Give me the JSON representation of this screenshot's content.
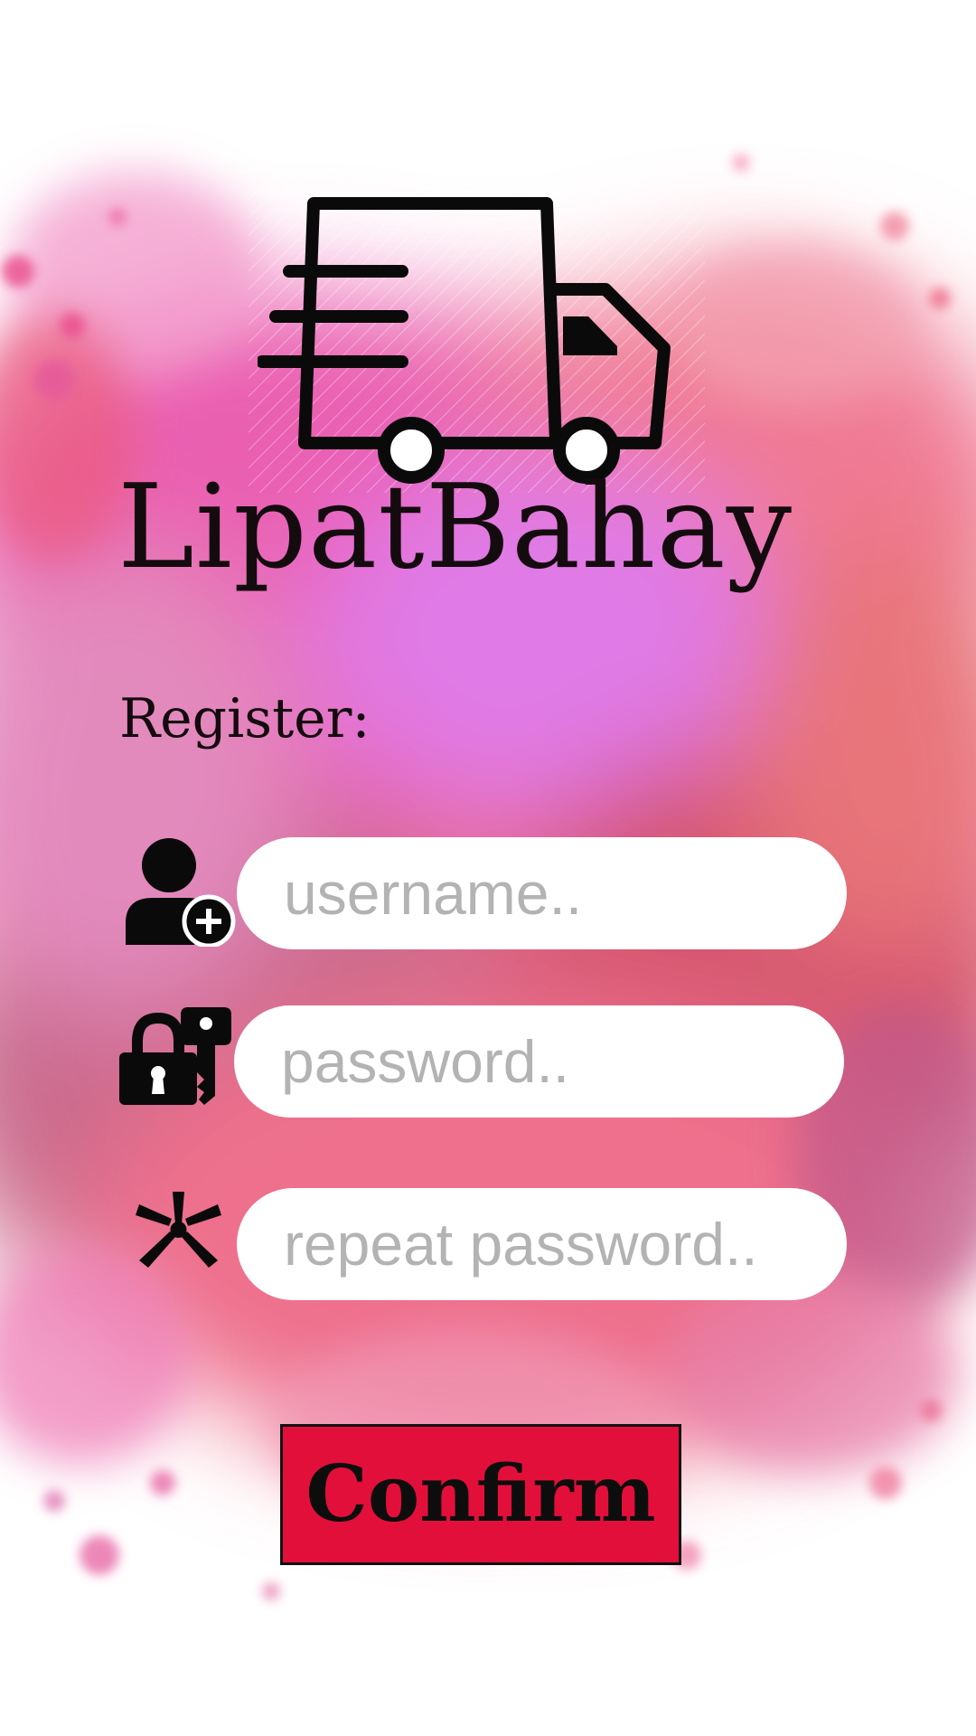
{
  "app": {
    "brand_name": "LipatBahay",
    "logo_icon": "delivery-truck-icon"
  },
  "form": {
    "heading": "Register:",
    "username": {
      "icon": "add-user-icon",
      "placeholder": "username..",
      "value": ""
    },
    "password": {
      "icon": "lock-key-icon",
      "placeholder": "password..",
      "value": ""
    },
    "repeat_password": {
      "icon": "asterisk-icon",
      "placeholder": "repeat password..",
      "value": ""
    },
    "confirm_label": "Confirm"
  },
  "colors": {
    "accent": "#e30f3b",
    "text": "#140b0e",
    "placeholder": "#b3b3b3",
    "field_bg": "#ffffff"
  }
}
